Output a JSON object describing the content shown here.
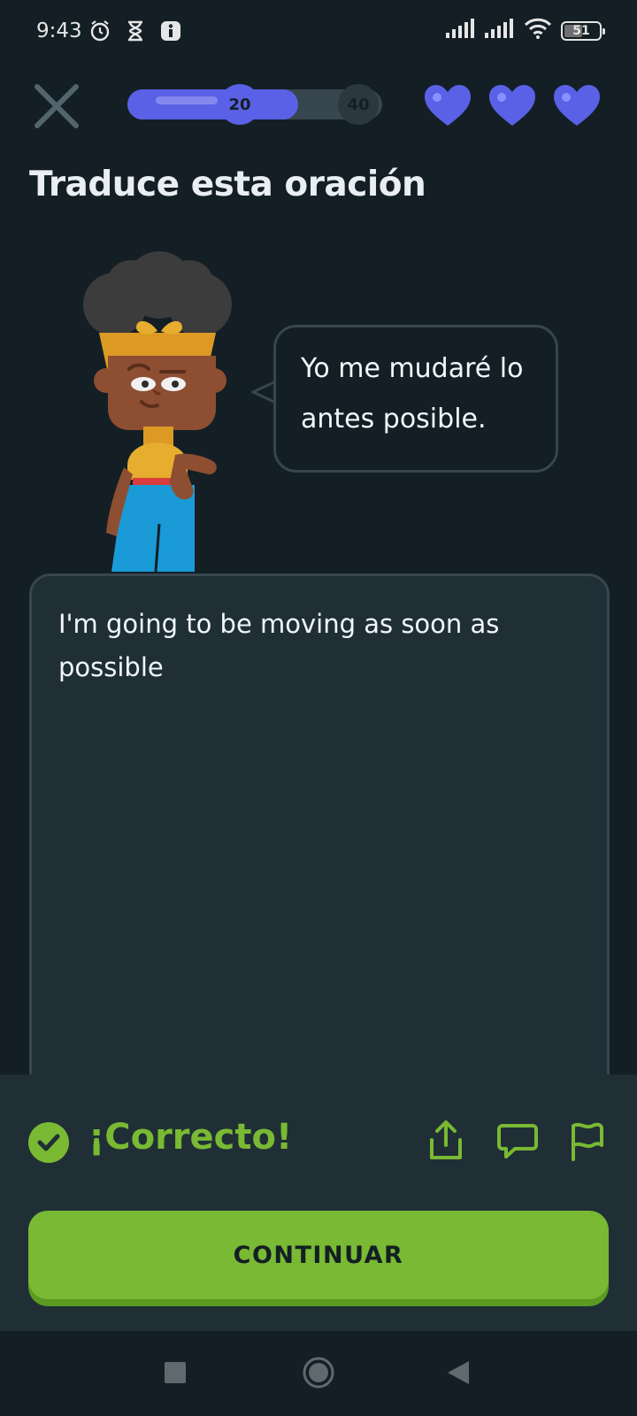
{
  "status_bar": {
    "time": "9:43",
    "left_icons": [
      "alarm-icon",
      "hourglass-icon",
      "info-icon"
    ],
    "right_icons": [
      "signal-icon",
      "signal-icon",
      "wifi-icon"
    ],
    "battery": "51"
  },
  "header": {
    "progress": {
      "fraction": 0.67,
      "milestone_current": "20",
      "milestone_next": "40"
    },
    "hearts": 3
  },
  "exercise": {
    "title": "Traduce esta oración",
    "prompt": "Yo me mudaré lo antes posible.",
    "answer": "I'm going to be moving as soon as possible"
  },
  "feedback": {
    "status": "¡Correcto!",
    "continue_label": "CONTINUAR"
  },
  "colors": {
    "background": "#131f24",
    "panel": "#202f36",
    "border": "#37464f",
    "success": "#79b933",
    "accent": "#5a61e6"
  }
}
